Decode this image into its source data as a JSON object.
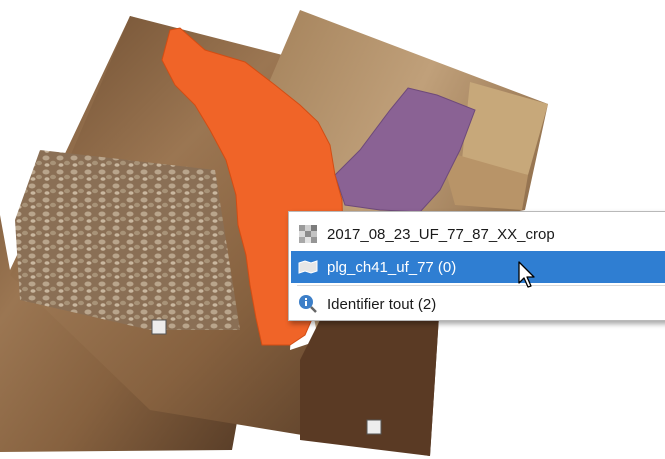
{
  "context_menu": {
    "items": [
      {
        "label": "2017_08_23_UF_77_87_XX_crop",
        "icon": "raster-layer-icon",
        "selected": false
      },
      {
        "label": "plg_ch41_uf_77 (0)",
        "icon": "polygon-layer-icon",
        "selected": true
      },
      {
        "label": "Identifier tout (2)",
        "icon": "identify-icon",
        "selected": false
      }
    ]
  },
  "colors": {
    "orange_polygon": "#f06428",
    "purple_polygon": "#8a6294",
    "selection_highlight": "#2f7ed2"
  }
}
